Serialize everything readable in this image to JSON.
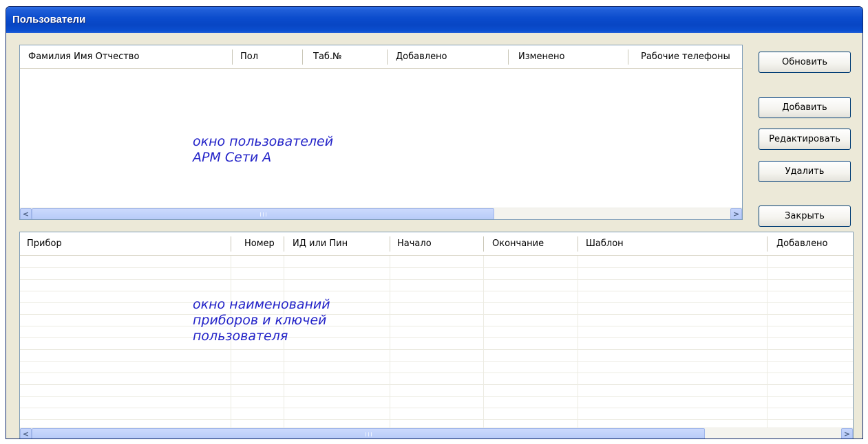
{
  "window": {
    "title": "Пользователи"
  },
  "users_grid": {
    "columns": [
      "Фамилия Имя Отчество",
      "Пол",
      "Таб.№",
      "Добавлено",
      "Изменено",
      "Рабочие телефоны"
    ],
    "annotation": [
      "окно пользователей",
      "АРМ Сети А"
    ]
  },
  "devices_grid": {
    "columns": [
      "Прибор",
      "Номер",
      "ИД или Пин",
      "Начало",
      "Окончание",
      "Шаблон",
      "Добавлено"
    ],
    "annotation": [
      "окно наименований",
      "приборов и ключей",
      "пользователя"
    ]
  },
  "buttons": {
    "refresh": "Обновить",
    "add": "Добавить",
    "edit": "Редактировать",
    "delete": "Удалить",
    "close": "Закрыть"
  },
  "icons": {
    "scroll_left": "arrow-left-icon",
    "scroll_right": "arrow-right-icon",
    "scroll_grip": "grip-icon"
  },
  "colors": {
    "titlebar": "#0a4bcc",
    "annotation": "#2323c8",
    "window_bg": "#ece9d8"
  }
}
